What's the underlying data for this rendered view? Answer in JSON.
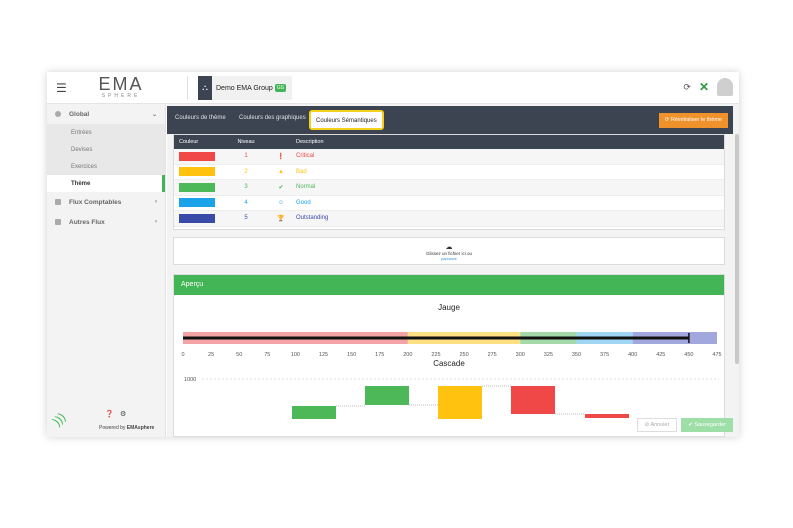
{
  "header": {
    "logo_main": "EMA",
    "logo_sub": "SPHERE",
    "org_name": "Demo EMA Group",
    "org_badge": "GS"
  },
  "sidebar": {
    "groups": [
      {
        "label": "Global"
      },
      {
        "label": "Flux Comptables"
      },
      {
        "label": "Autres Flux"
      }
    ],
    "sub_items": [
      {
        "label": "Entrées"
      },
      {
        "label": "Devises"
      },
      {
        "label": "Exercices"
      },
      {
        "label": "Thème"
      }
    ],
    "powered_prefix": "Powered by",
    "powered_brand": "EMAsphere"
  },
  "tabs": [
    {
      "label": "Couleurs de thème"
    },
    {
      "label": "Couleurs des graphiques"
    },
    {
      "label": "Couleurs Sémantiques"
    }
  ],
  "reset_button": "Réinitialiser le thème",
  "table": {
    "headers": [
      "Couleur",
      "Niveau",
      "",
      "Description"
    ],
    "rows": [
      {
        "color": "#f04747",
        "level": "1",
        "icon": "error-icon",
        "glyph": "❗",
        "desc": "Critical"
      },
      {
        "color": "#ffc20e",
        "level": "2",
        "icon": "warning-icon",
        "glyph": "▲",
        "desc": "Bad"
      },
      {
        "color": "#4cb857",
        "level": "3",
        "icon": "check-icon",
        "glyph": "✔",
        "desc": "Normal"
      },
      {
        "color": "#1aa3e8",
        "level": "4",
        "icon": "smile-icon",
        "glyph": "☺",
        "desc": "Good"
      },
      {
        "color": "#3a4aa8",
        "level": "5",
        "icon": "trophy-icon",
        "glyph": "🏆",
        "desc": "Outstanding"
      }
    ]
  },
  "upload": {
    "text": "Glissez un fichier ici ou",
    "link": "parcourir"
  },
  "preview": {
    "title": "Aperçu",
    "gauge_title": "Jauge",
    "cascade_title": "Cascade"
  },
  "chart_data": [
    {
      "type": "bar",
      "title": "Jauge",
      "xlim": [
        0,
        475
      ],
      "ticks": [
        0,
        25,
        50,
        75,
        100,
        125,
        150,
        175,
        200,
        225,
        250,
        275,
        300,
        325,
        350,
        375,
        400,
        425,
        450,
        475
      ],
      "bands": [
        {
          "from": 0,
          "to": 200,
          "color": "#f3a3a3"
        },
        {
          "from": 200,
          "to": 300,
          "color": "#ffe082"
        },
        {
          "from": 300,
          "to": 350,
          "color": "#a5d9a9"
        },
        {
          "from": 350,
          "to": 400,
          "color": "#9fd6f3"
        },
        {
          "from": 400,
          "to": 475,
          "color": "#a2a8de"
        }
      ],
      "value": 450
    },
    {
      "type": "bar",
      "title": "Cascade",
      "yticks": [
        1000
      ],
      "steps": [
        {
          "color": "#4cb857"
        },
        {
          "color": "#4cb857"
        },
        {
          "color": "#ffc20e"
        },
        {
          "color": "#f04747"
        },
        {
          "color": "#f04747"
        }
      ]
    }
  ],
  "footer": {
    "cancel": "Annuler",
    "save": "Sauvegarder"
  }
}
